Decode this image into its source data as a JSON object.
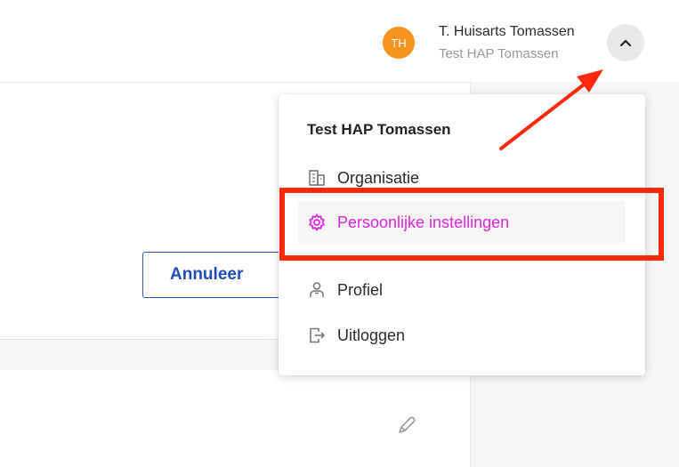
{
  "user": {
    "initials": "TH",
    "name": "T. Huisarts Tomassen",
    "organization": "Test HAP Tomassen"
  },
  "form": {
    "cancel_label": "Annuleer"
  },
  "dropdown": {
    "title": "Test HAP Tomassen",
    "items": [
      {
        "label": "Organisatie",
        "icon": "building-icon"
      },
      {
        "label": "Persoonlijke instellingen",
        "icon": "gear-icon",
        "highlighted": true
      },
      {
        "label": "Profiel",
        "icon": "person-icon"
      },
      {
        "label": "Uitloggen",
        "icon": "logout-icon"
      }
    ]
  },
  "colors": {
    "avatar": "#f7941d",
    "accent_link": "#e025e0",
    "annotation": "#ff2a0d",
    "button_blue": "#1f4fb6"
  }
}
